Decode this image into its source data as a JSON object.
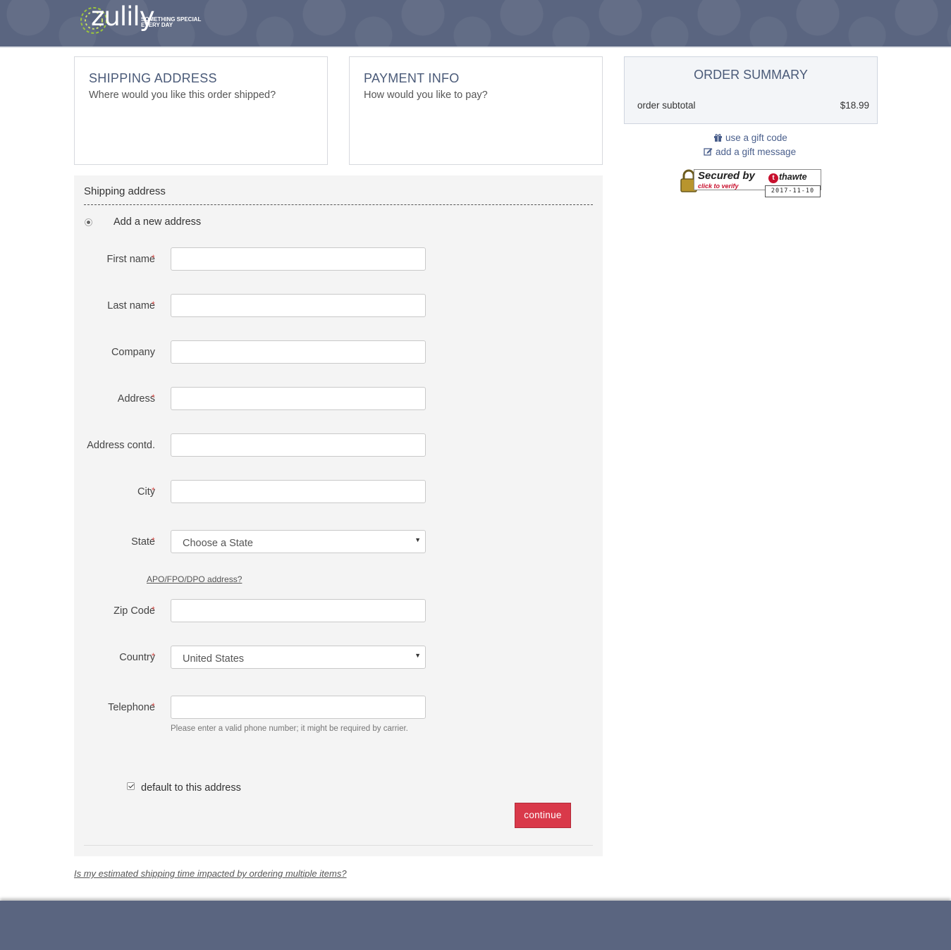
{
  "header": {
    "logo_text": "zulily",
    "tagline_line1": "SOMETHING SPECIAL",
    "tagline_line2": "EVERY DAY"
  },
  "steps": {
    "shipping": {
      "title": "SHIPPING ADDRESS",
      "subtitle": "Where would you like this order shipped?"
    },
    "payment": {
      "title": "PAYMENT INFO",
      "subtitle": "How would you like to pay?"
    }
  },
  "summary": {
    "title": "ORDER SUMMARY",
    "subtotal_label": "order subtotal",
    "subtotal_value": "$18.99",
    "gift_code_link": "use a gift code",
    "gift_message_link": "add a gift message"
  },
  "seal": {
    "title": "Secured by",
    "brand": "thawte",
    "verify": "click to verify",
    "date": "2017-11-10"
  },
  "form": {
    "section_title": "Shipping address",
    "new_address_label": "Add a new address",
    "required_mark": "*",
    "fields": {
      "first_name": {
        "label": "First name",
        "value": ""
      },
      "last_name": {
        "label": "Last name",
        "value": ""
      },
      "company": {
        "label": "Company",
        "value": ""
      },
      "address": {
        "label": "Address",
        "value": ""
      },
      "address_contd": {
        "label": "Address contd.",
        "value": ""
      },
      "city": {
        "label": "City",
        "value": ""
      },
      "state": {
        "label": "State",
        "selected": "Choose a State"
      },
      "zip": {
        "label": "Zip Code",
        "value": ""
      },
      "country": {
        "label": "Country",
        "selected": "United States"
      },
      "telephone": {
        "label": "Telephone",
        "value": ""
      }
    },
    "apo_link": "APO/FPO/DPO address?",
    "phone_hint": "Please enter a valid phone number; it might be required by carrier.",
    "default_checkbox_label": "default to this address",
    "default_checked": true,
    "continue_label": "continue"
  },
  "shipping_time_link": "Is my estimated shipping time impacted by ordering multiple items?",
  "colors": {
    "header_bg": "#5a6580",
    "accent_button": "#d9394a",
    "link": "#4a5f8c",
    "required": "#d9534f"
  }
}
